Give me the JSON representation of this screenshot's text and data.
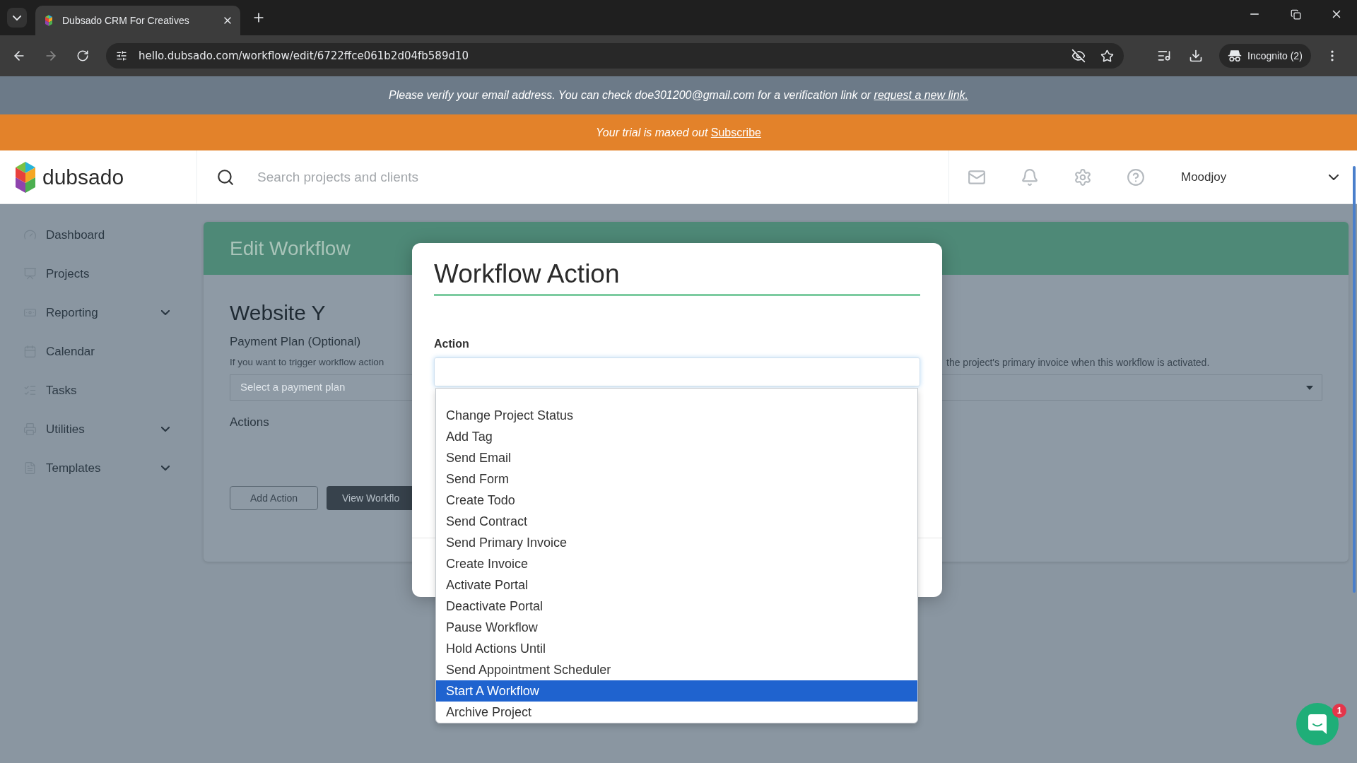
{
  "browser": {
    "tab": {
      "title": "Dubsado CRM For Creatives"
    },
    "url": "hello.dubsado.com/workflow/edit/6722ffce061b2d04fb589d10",
    "profile": "Incognito (2)"
  },
  "verify_banner": {
    "text": "Please verify your email address. You can check doe301200@gmail.com for a verification link or",
    "link": "request a new link."
  },
  "trial_banner": {
    "text": "Your trial is maxed out",
    "link": "Subscribe"
  },
  "header": {
    "logo": "dubsado",
    "search": {
      "placeholder": "Search projects and clients"
    },
    "user": "Moodjoy"
  },
  "sidebar": {
    "items": [
      {
        "label": "Dashboard",
        "submenu": false
      },
      {
        "label": "Projects",
        "submenu": false
      },
      {
        "label": "Reporting",
        "submenu": true
      },
      {
        "label": "Calendar",
        "submenu": false
      },
      {
        "label": "Tasks",
        "submenu": false
      },
      {
        "label": "Utilities",
        "submenu": true
      },
      {
        "label": "Templates",
        "submenu": true
      }
    ]
  },
  "page": {
    "title": "Edit Workflow",
    "workflow_name": "Website Y",
    "payment_plan": {
      "label": "Payment Plan (Optional)",
      "hint": [
        "If you want to trigger workflow action",
        "the project's primary invoice when this workflow is activated."
      ],
      "placeholder": "Select a payment plan"
    },
    "actions_label": "Actions",
    "buttons": [
      {
        "label": "Add Action",
        "kind": "outline"
      },
      {
        "label": "View Workflo",
        "kind": "solid"
      }
    ]
  },
  "modal": {
    "title": "Workflow Action",
    "field_label": "Action",
    "options": [
      {
        "label": "Change Project Status",
        "selected": false
      },
      {
        "label": "Add Tag",
        "selected": false
      },
      {
        "label": "Send Email",
        "selected": false
      },
      {
        "label": "Send Form",
        "selected": false
      },
      {
        "label": "Create Todo",
        "selected": false
      },
      {
        "label": "Send Contract",
        "selected": false
      },
      {
        "label": "Send Primary Invoice",
        "selected": false
      },
      {
        "label": "Create Invoice",
        "selected": false
      },
      {
        "label": "Activate Portal",
        "selected": false
      },
      {
        "label": "Deactivate Portal",
        "selected": false
      },
      {
        "label": "Pause Workflow",
        "selected": false
      },
      {
        "label": "Hold Actions Until",
        "selected": false
      },
      {
        "label": "Send Appointment Scheduler",
        "selected": false
      },
      {
        "label": "Start A Workflow",
        "selected": true
      },
      {
        "label": "Archive Project",
        "selected": false
      }
    ]
  },
  "chat": {
    "badge": "1"
  }
}
